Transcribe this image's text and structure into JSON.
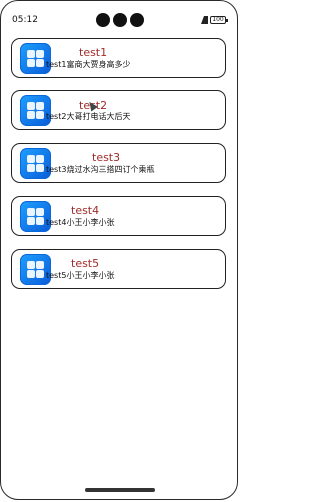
{
  "status_bar": {
    "time": "05:12",
    "battery_label": "100"
  },
  "items": [
    {
      "title": "test1",
      "description": "test1富商大贾身高多少",
      "icon": "app-grid-icon"
    },
    {
      "title": "test2",
      "description": "test2大哥打电话大后天",
      "icon": "app-grid-icon"
    },
    {
      "title": "test3",
      "description": "test3烧过水沟三搭四订个乘瓶",
      "icon": "app-grid-icon"
    },
    {
      "title": "test4",
      "description": "test4小王小李小张",
      "icon": "app-grid-icon"
    },
    {
      "title": "test5",
      "description": "test5小王小李小张",
      "icon": "app-grid-icon"
    }
  ],
  "colors": {
    "title": "#a12b2b",
    "icon_blue": "#1ea0ff",
    "border": "#222222"
  }
}
